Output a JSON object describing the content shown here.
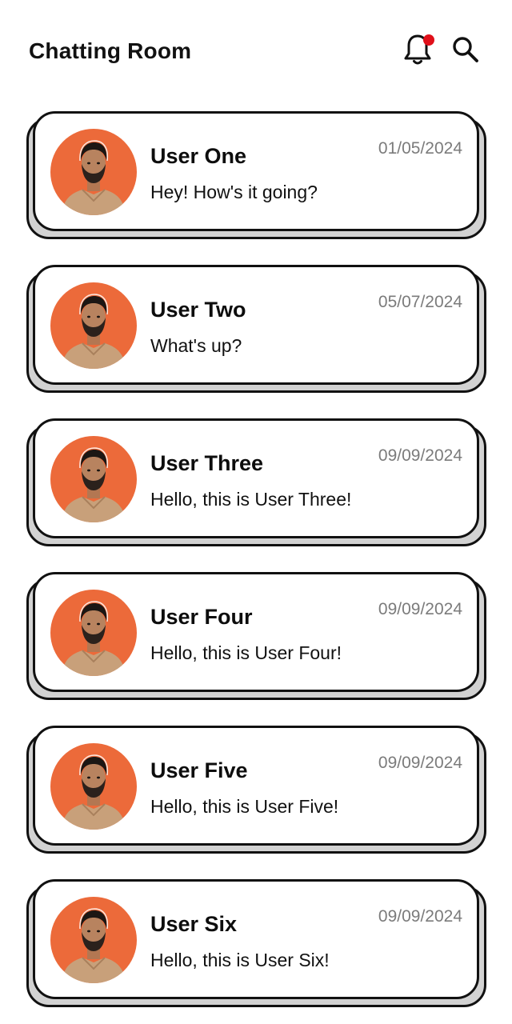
{
  "header": {
    "title": "Chatting Room",
    "bell_icon": "bell-icon",
    "search_icon": "search-icon",
    "notification_dot_color": "#e0101a"
  },
  "colors": {
    "avatar_bg": "#ec6a3a",
    "card_shadow": "#d2d2d2",
    "date_text": "#7b7b7b"
  },
  "chats": [
    {
      "name": "User One",
      "message": "Hey! How's it going?",
      "date": "01/05/2024"
    },
    {
      "name": "User Two",
      "message": "What's up?",
      "date": "05/07/2024"
    },
    {
      "name": "User Three",
      "message": "Hello, this is User Three!",
      "date": "09/09/2024"
    },
    {
      "name": "User Four",
      "message": "Hello, this is User Four!",
      "date": "09/09/2024"
    },
    {
      "name": "User Five",
      "message": "Hello, this is User Five!",
      "date": "09/09/2024"
    },
    {
      "name": "User Six",
      "message": "Hello, this is User Six!",
      "date": "09/09/2024"
    }
  ]
}
